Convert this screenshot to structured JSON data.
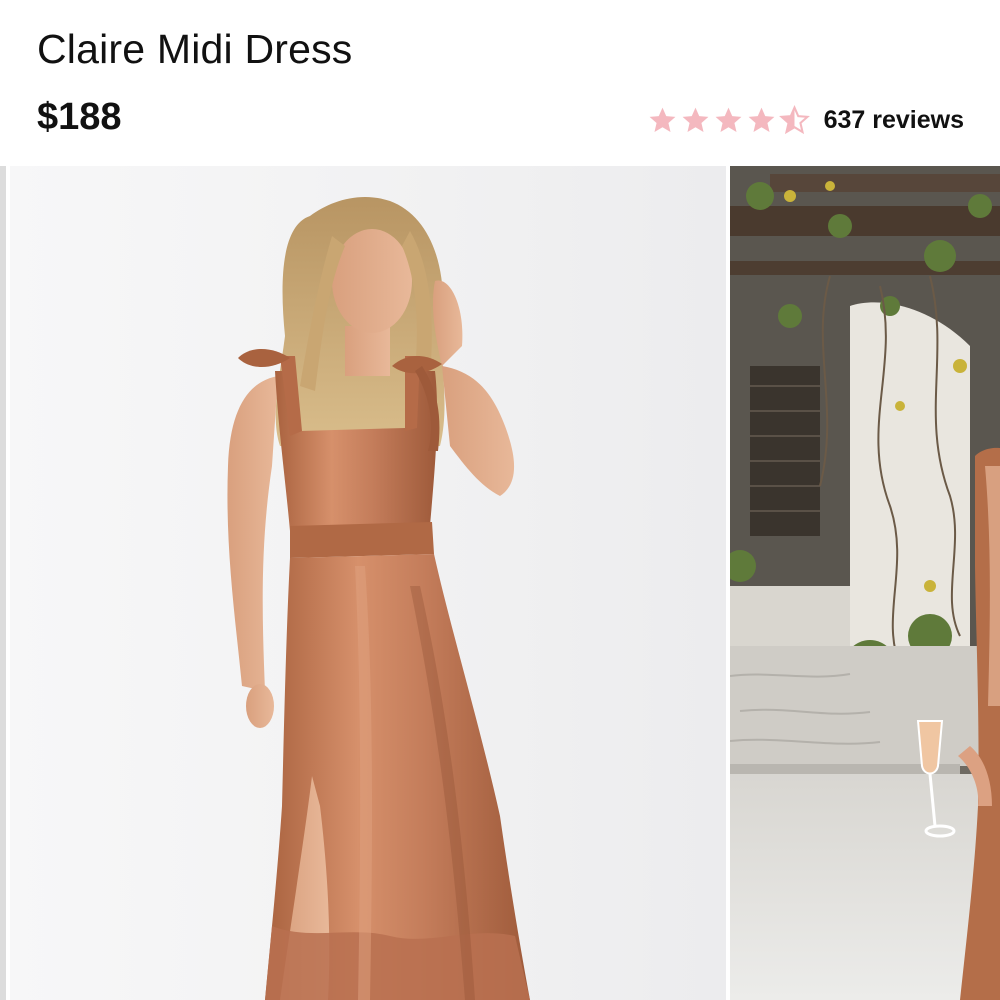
{
  "product": {
    "title": "Claire Midi Dress",
    "price": "$188",
    "rating": {
      "value": 4.5,
      "max": 5,
      "reviews_label": "637 reviews",
      "star_color": "#f4b8bf"
    }
  },
  "gallery": {
    "images": [
      {
        "name": "model-studio-photo"
      },
      {
        "name": "model-garden-photo"
      }
    ],
    "dress_color": "#c47d5b"
  },
  "colors": {
    "text": "#111111",
    "background": "#ffffff",
    "star": "#f4b8bf"
  }
}
